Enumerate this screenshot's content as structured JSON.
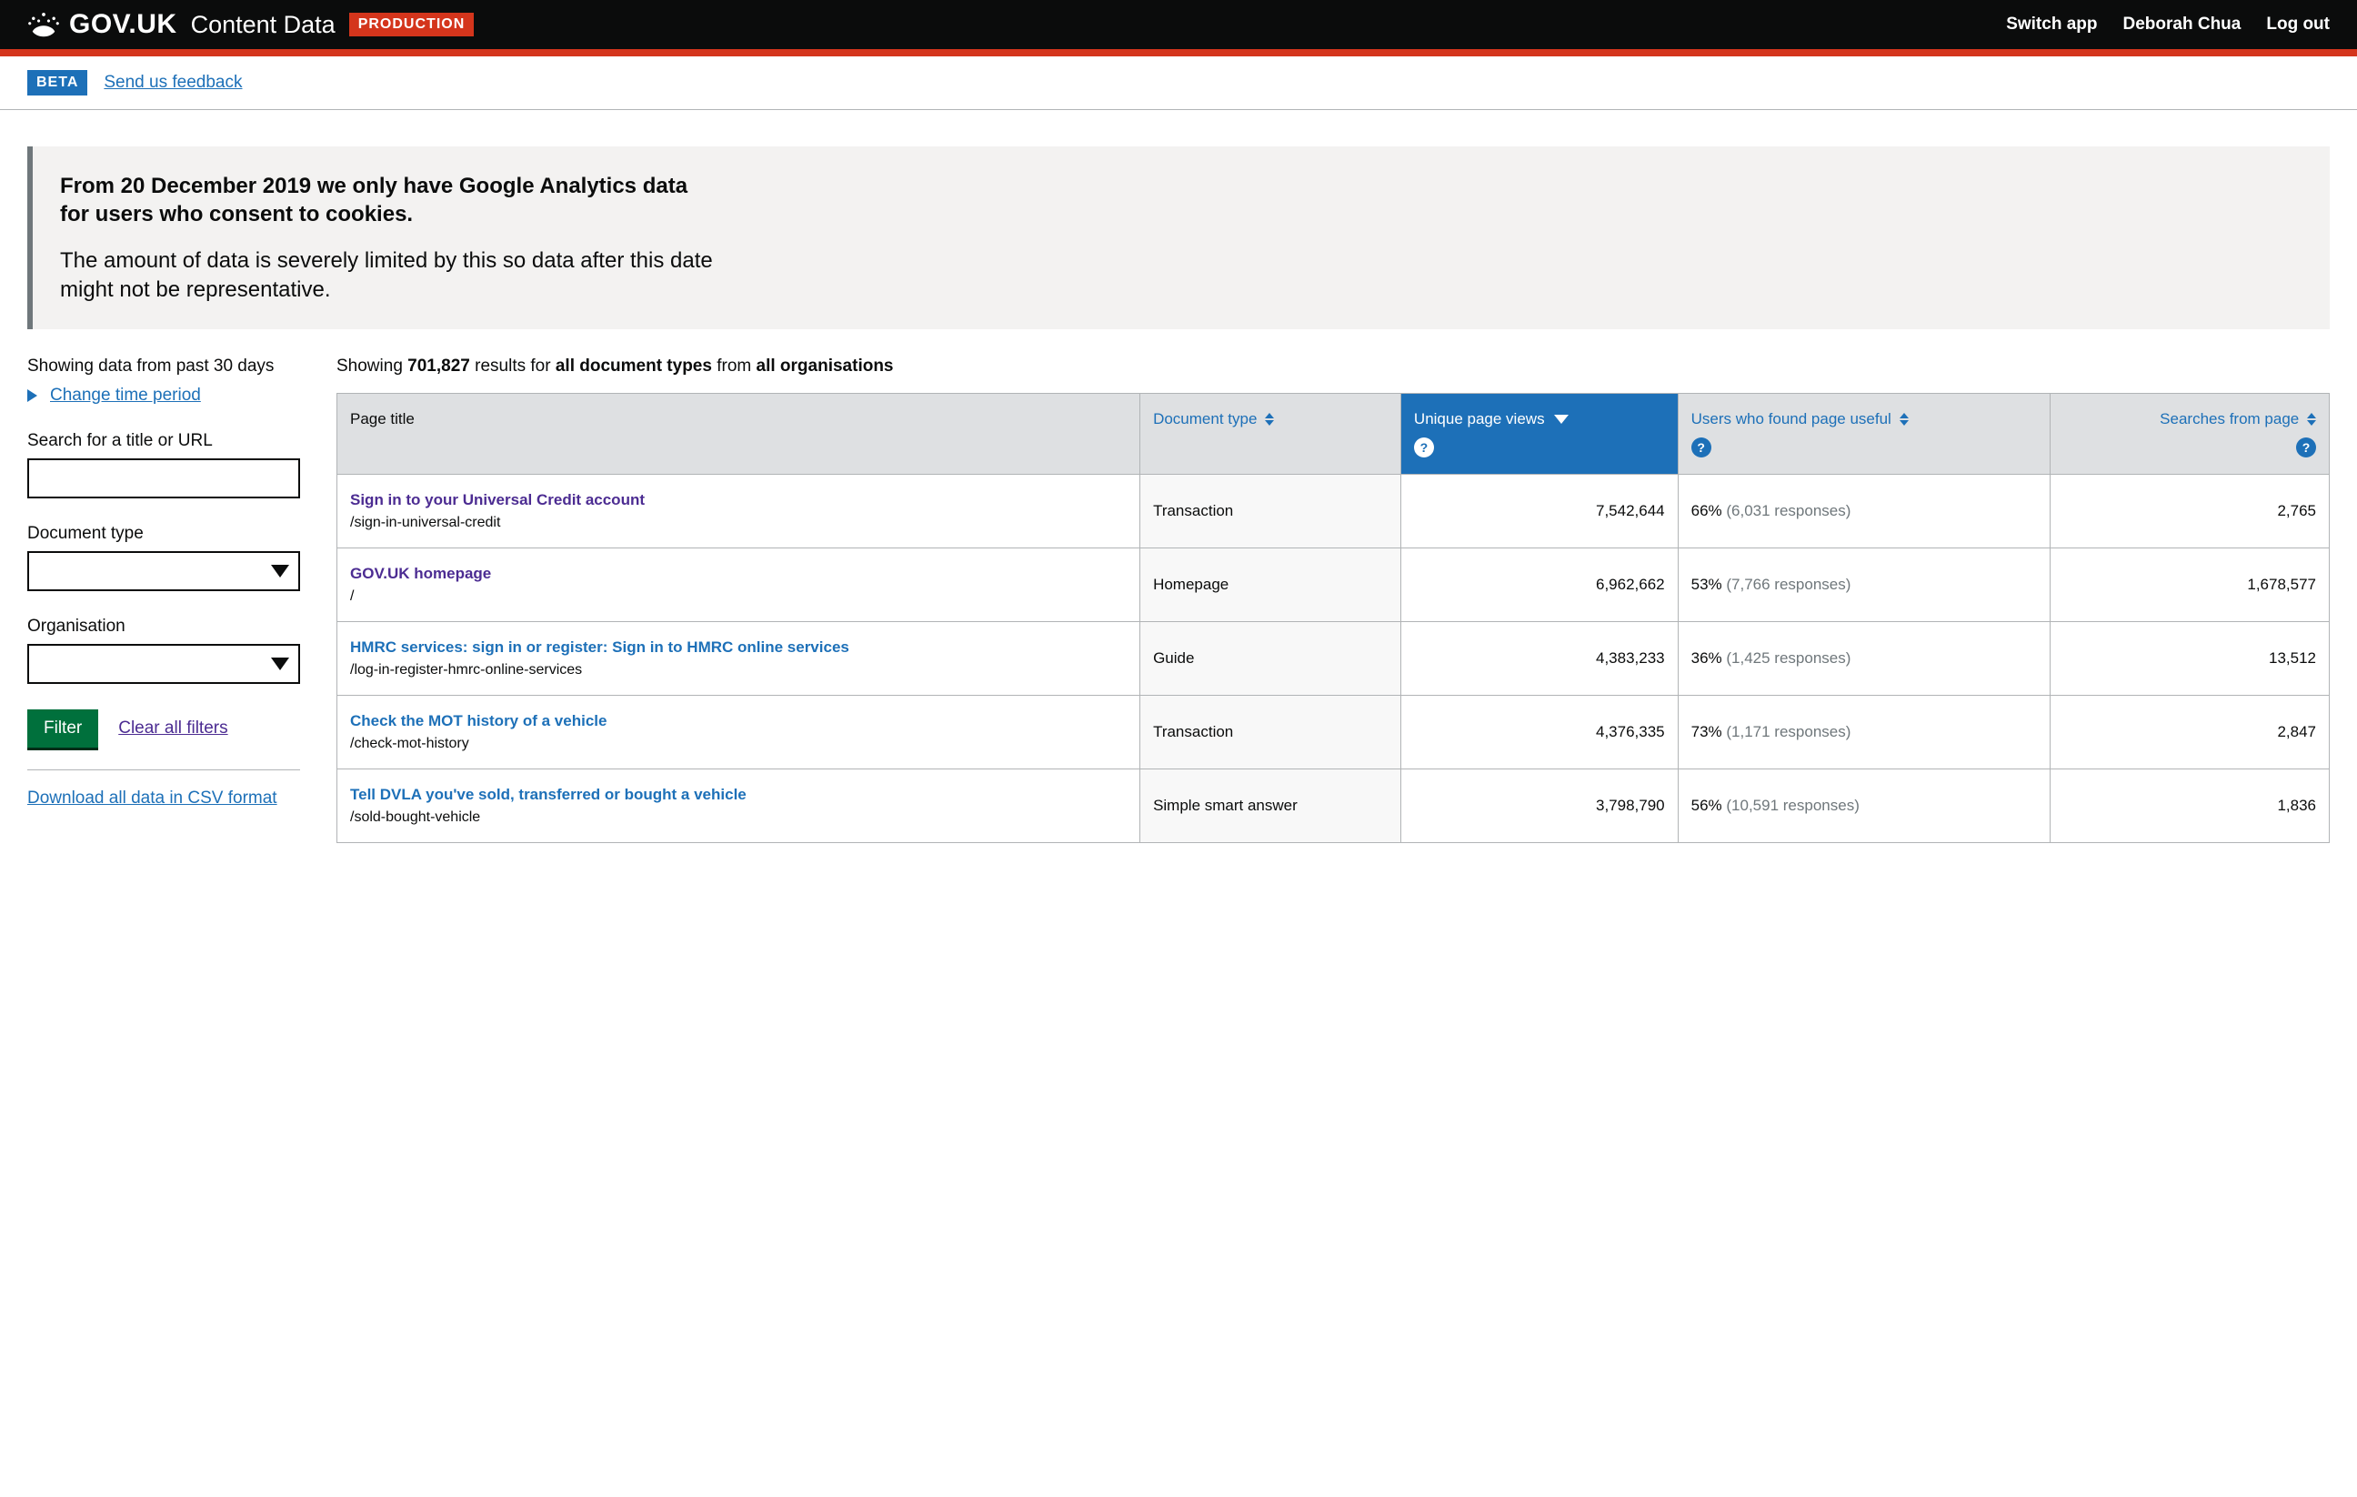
{
  "header": {
    "govuk": "GOV.UK",
    "app_name": "Content Data",
    "env_tag": "PRODUCTION",
    "switch_app": "Switch app",
    "user_name": "Deborah Chua",
    "logout": "Log out"
  },
  "phase": {
    "tag": "BETA",
    "feedback": "Send us feedback"
  },
  "notice": {
    "p1": "From 20 December 2019 we only have Google Analytics data for users who consent to cookies.",
    "p2": "The amount of data is severely limited by this so data after this date might not be representative."
  },
  "sidebar": {
    "showing_period": "Showing data from past 30 days",
    "change_time": "Change time period",
    "search_label": "Search for a title or URL",
    "doc_type_label": "Document type",
    "org_label": "Organisation",
    "filter_btn": "Filter",
    "clear_filters": "Clear all filters",
    "csv_link": "Download all data in CSV format"
  },
  "results": {
    "caption_prefix": "Showing ",
    "count": "701,827",
    "caption_mid": " results for ",
    "doc_types": "all document types",
    "caption_from": " from ",
    "orgs": "all organisations"
  },
  "columns": {
    "page_title": "Page title",
    "doc_type": "Document type",
    "unique_views": "Unique page views",
    "useful": "Users who found page useful",
    "searches": "Searches from page"
  },
  "rows": [
    {
      "title": "Sign in to your Universal Credit account",
      "path": "/sign-in-universal-credit",
      "visited": true,
      "doc_type": "Transaction",
      "views": "7,542,644",
      "useful_pct": "66%",
      "useful_resp": "(6,031 responses)",
      "searches": "2,765"
    },
    {
      "title": "GOV.UK homepage",
      "path": "/",
      "visited": true,
      "doc_type": "Homepage",
      "views": "6,962,662",
      "useful_pct": "53%",
      "useful_resp": "(7,766 responses)",
      "searches": "1,678,577"
    },
    {
      "title": "HMRC services: sign in or register: Sign in to HMRC online services",
      "path": "/log-in-register-hmrc-online-services",
      "visited": false,
      "doc_type": "Guide",
      "views": "4,383,233",
      "useful_pct": "36%",
      "useful_resp": "(1,425 responses)",
      "searches": "13,512"
    },
    {
      "title": "Check the MOT history of a vehicle",
      "path": "/check-mot-history",
      "visited": false,
      "doc_type": "Transaction",
      "views": "4,376,335",
      "useful_pct": "73%",
      "useful_resp": "(1,171 responses)",
      "searches": "2,847"
    },
    {
      "title": "Tell DVLA you've sold, transferred or bought a vehicle",
      "path": "/sold-bought-vehicle",
      "visited": false,
      "doc_type": "Simple smart answer",
      "views": "3,798,790",
      "useful_pct": "56%",
      "useful_resp": "(10,591 responses)",
      "searches": "1,836"
    }
  ]
}
